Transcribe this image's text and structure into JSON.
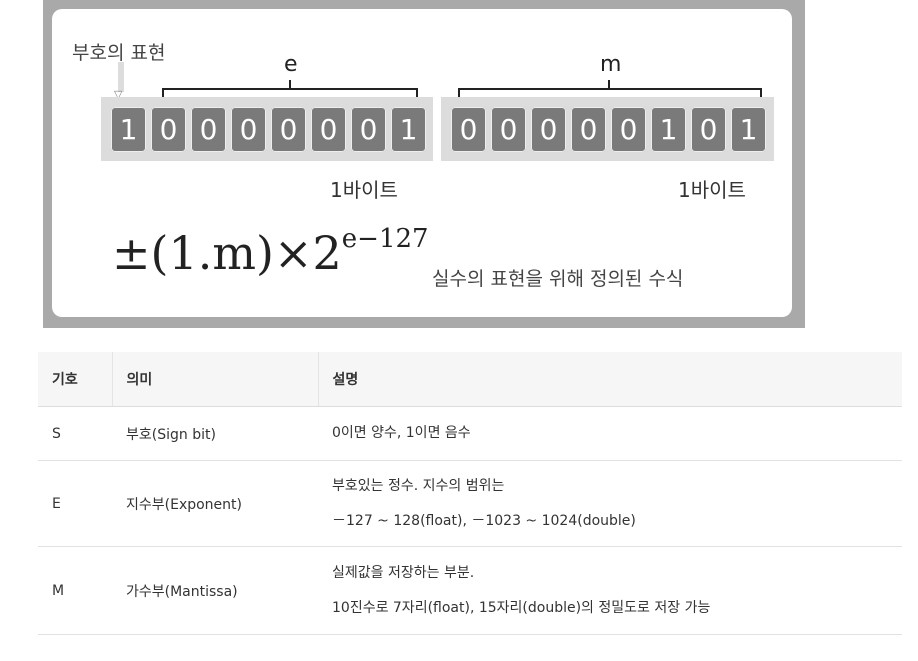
{
  "figure": {
    "sign_label": "부호의 표현",
    "exponent_label": "e",
    "mantissa_label": "m",
    "exponent_bits": [
      "1",
      "0",
      "0",
      "0",
      "0",
      "0",
      "0",
      "1"
    ],
    "mantissa_bits": [
      "0",
      "0",
      "0",
      "0",
      "0",
      "1",
      "0",
      "1"
    ],
    "byte_label_1": "1바이트",
    "byte_label_2": "1바이트",
    "formula_main": "±(1.m)×2",
    "formula_exp": "e−127",
    "caption": "실수의 표현을 위해 정의된 수식"
  },
  "table": {
    "headers": [
      "기호",
      "의미",
      "설명"
    ],
    "rows": [
      {
        "symbol": "S",
        "meaning": "부호(Sign bit)",
        "desc": [
          "0이면 양수, 1이면 음수"
        ]
      },
      {
        "symbol": "E",
        "meaning": "지수부(Exponent)",
        "desc": [
          "부호있는 정수. 지수의 범위는",
          "－127 ~ 128(float), －1023 ~ 1024(double)"
        ]
      },
      {
        "symbol": "M",
        "meaning": "가수부(Mantissa)",
        "desc": [
          "실제값을 저장하는 부분.",
          "10진수로 7자리(float), 15자리(double)의 정밀도로 저장 가능"
        ]
      }
    ]
  }
}
